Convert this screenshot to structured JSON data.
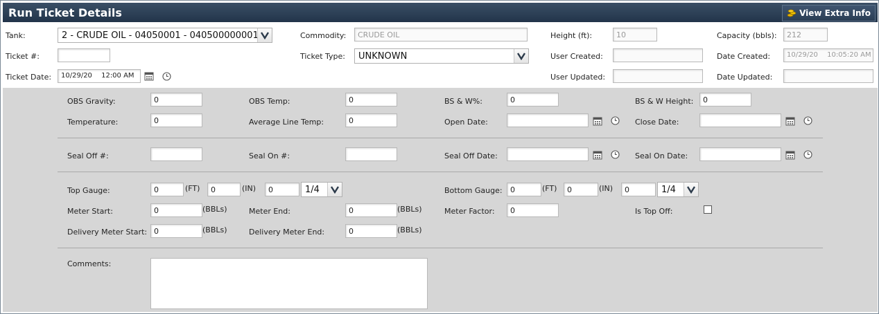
{
  "header": {
    "title": "Run Ticket Details",
    "extra_button": "View Extra Info"
  },
  "top": {
    "tank_label": "Tank:",
    "tank_value": "2 - CRUDE OIL - 04050001 - 040500000001",
    "ticket_no_label": "Ticket #:",
    "ticket_no_value": "",
    "ticket_date_label": "Ticket Date:",
    "ticket_date_value": "10/29/20  12:00 AM",
    "commodity_label": "Commodity:",
    "commodity_value": "CRUDE OIL",
    "ticket_type_label": "Ticket Type:",
    "ticket_type_value": "UNKNOWN",
    "height_label": "Height (ft):",
    "height_value": "10",
    "user_created_label": "User Created:",
    "user_created_value": "",
    "user_updated_label": "User Updated:",
    "user_updated_value": "",
    "capacity_label": "Capacity (bbls):",
    "capacity_value": "212",
    "date_created_label": "Date Created:",
    "date_created_value": "10/29/20  10:05:20 AM",
    "date_updated_label": "Date Updated:",
    "date_updated_value": ""
  },
  "measures": {
    "obs_gravity_label": "OBS Gravity:",
    "obs_gravity_value": "0",
    "obs_temp_label": "OBS Temp:",
    "obs_temp_value": "0",
    "bsw_pct_label": "BS & W%:",
    "bsw_pct_value": "0",
    "bsw_height_label": "BS & W Height:",
    "bsw_height_value": "0",
    "temperature_label": "Temperature:",
    "temperature_value": "0",
    "avg_line_temp_label": "Average Line Temp:",
    "avg_line_temp_value": "0",
    "open_date_label": "Open Date:",
    "open_date_value": "",
    "close_date_label": "Close Date:",
    "close_date_value": ""
  },
  "seals": {
    "seal_off_label": "Seal Off #:",
    "seal_off_value": "",
    "seal_on_label": "Seal On #:",
    "seal_on_value": "",
    "seal_off_date_label": "Seal Off Date:",
    "seal_off_date_value": "",
    "seal_on_date_label": "Seal On Date:",
    "seal_on_date_value": ""
  },
  "gauges": {
    "top_gauge_label": "Top Gauge:",
    "top_ft": "0",
    "top_in": "0",
    "top_frac_num": "0",
    "top_frac": "1/4",
    "bottom_gauge_label": "Bottom Gauge:",
    "bottom_ft": "0",
    "bottom_in": "0",
    "bottom_frac_num": "0",
    "bottom_frac": "1/4",
    "ft_unit": "(FT)",
    "in_unit": "(IN)",
    "bbl_unit": "(BBLs)",
    "meter_start_label": "Meter Start:",
    "meter_start_value": "0",
    "meter_end_label": "Meter End:",
    "meter_end_value": "0",
    "meter_factor_label": "Meter Factor:",
    "meter_factor_value": "0",
    "is_top_off_label": "Is Top Off:",
    "delivery_start_label": "Delivery Meter Start:",
    "delivery_start_value": "0",
    "delivery_end_label": "Delivery Meter End:",
    "delivery_end_value": "0"
  },
  "comments": {
    "label": "Comments:",
    "value": ""
  }
}
